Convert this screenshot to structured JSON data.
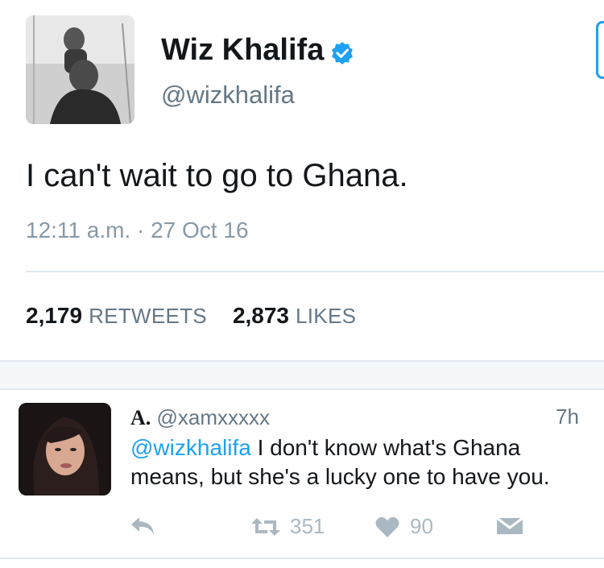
{
  "tweet": {
    "author_name": "Wiz Khalifa",
    "author_handle": "@wizkhalifa",
    "text": "I can't wait to go to Ghana.",
    "timestamp": "12:11 a.m. · 27 Oct 16",
    "retweets_count": "2,179",
    "retweets_label": "RETWEETS",
    "likes_count": "2,873",
    "likes_label": "LIKES"
  },
  "reply": {
    "name": "A.",
    "handle": "@xamxxxxx",
    "time": "7h",
    "mention": "@wizkhalifa",
    "text": " I don't know what's Ghana means, but she's a lucky one to have you.",
    "retweets": "351",
    "likes": "90"
  },
  "icons": {
    "verified": "verified-badge-icon",
    "reply": "reply-arrow-icon",
    "retweet": "retweet-icon",
    "like": "heart-icon",
    "dm": "envelope-icon"
  },
  "colors": {
    "accent": "#1da1f2",
    "text": "#14171a",
    "muted": "#657786",
    "icon_muted": "#aab8c2"
  }
}
